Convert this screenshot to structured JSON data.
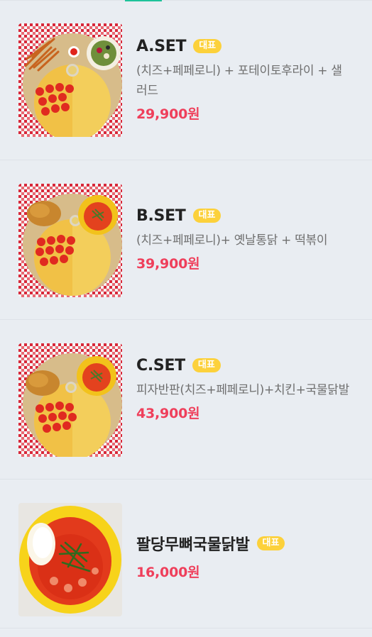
{
  "menu": {
    "badge_label": "대표",
    "items": [
      {
        "name": "A.SET",
        "desc": "(치즈+페페로니) + 포테이토후라이 + 샐러드",
        "price": "29,900원",
        "image": "pizza-fries-salad-set"
      },
      {
        "name": "B.SET",
        "desc": "(치즈+페페로니)+ 옛날통닭 + 떡볶이",
        "price": "39,900원",
        "image": "pizza-chicken-tteokbokki-set"
      },
      {
        "name": "C.SET",
        "desc": "피자반판(치즈+페페로니)+치킨+국물닭발",
        "price": "43,900원",
        "image": "pizza-chicken-dakbal-set"
      },
      {
        "name": "팔당무뼈국물닭발",
        "desc": "",
        "price": "16,000원",
        "image": "boneless-chicken-feet-soup"
      }
    ]
  },
  "colors": {
    "accent": "#1ec29a",
    "badge": "#fcd13b",
    "price": "#ef3f5b",
    "background": "#e9edf2"
  }
}
